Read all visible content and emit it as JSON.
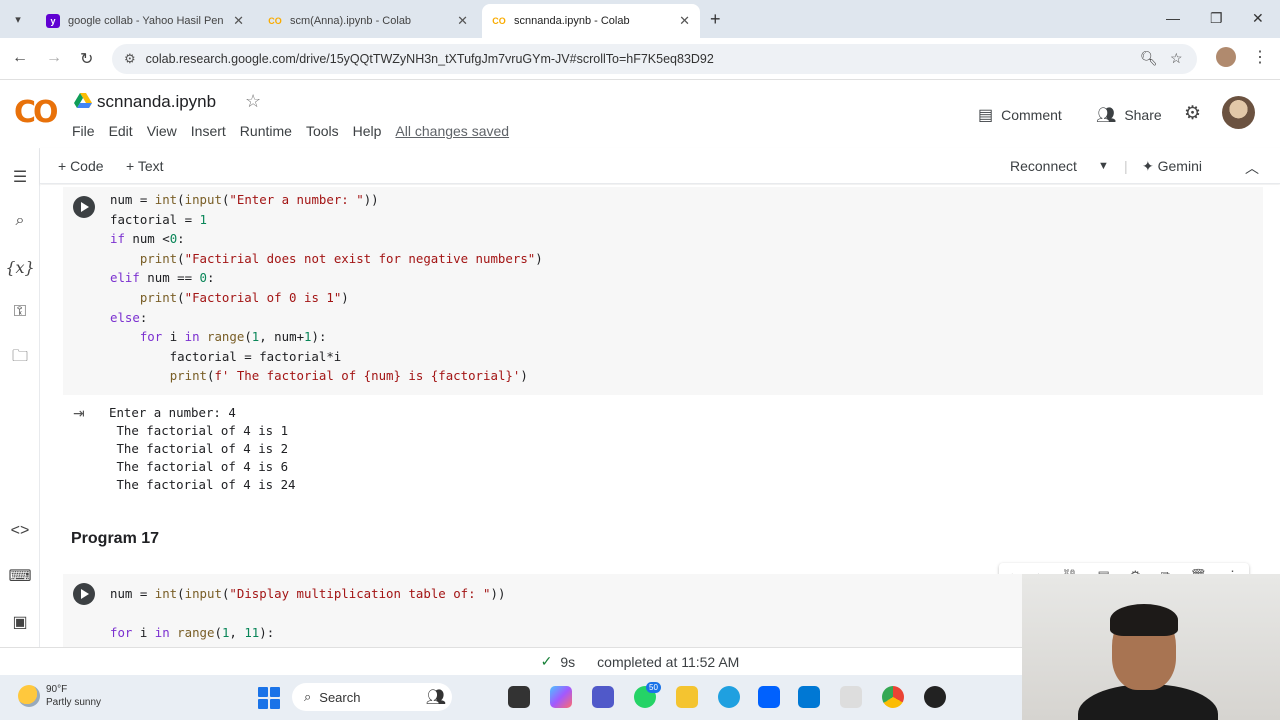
{
  "browser": {
    "tabs": [
      {
        "label": "google collab - Yahoo Hasil Pen",
        "icon": "yahoo-icon"
      },
      {
        "label": "scm(Anna).ipynb - Colab",
        "icon": "colab-icon"
      },
      {
        "label": "scnnanda.ipynb - Colab",
        "icon": "colab-icon"
      }
    ],
    "url": "colab.research.google.com/drive/15yQQtTWZyNH3n_tXTufgJm7vruGYm-JV#scrollTo=hF7K5eq83D92"
  },
  "colab": {
    "logo": "CO",
    "notebook_name": "scnnanda.ipynb",
    "menu": [
      "File",
      "Edit",
      "View",
      "Insert",
      "Runtime",
      "Tools",
      "Help"
    ],
    "saved_status": "All changes saved",
    "comment_label": "Comment",
    "share_label": "Share",
    "toolbar": {
      "add_code": "+ Code",
      "add_text": "+ Text",
      "reconnect": "Reconnect",
      "gemini": "Gemini"
    }
  },
  "cell1": {
    "output": [
      "Enter a number: 4",
      " The factorial of 4 is 1",
      " The factorial of 4 is 2",
      " The factorial of 4 is 6",
      " The factorial of 4 is 24"
    ]
  },
  "section_heading": "Program 17",
  "status": {
    "check": "✓",
    "duration": "9s",
    "completed": "completed at 11:52 AM"
  },
  "taskbar": {
    "temperature": "90°F",
    "weather": "Partly sunny",
    "search_placeholder": "Search",
    "badge": "50"
  },
  "colors": {
    "accent": "#1a73e8",
    "colab_orange": "#f9ab00",
    "keyword": "#7b30d0",
    "string": "#a31515"
  }
}
